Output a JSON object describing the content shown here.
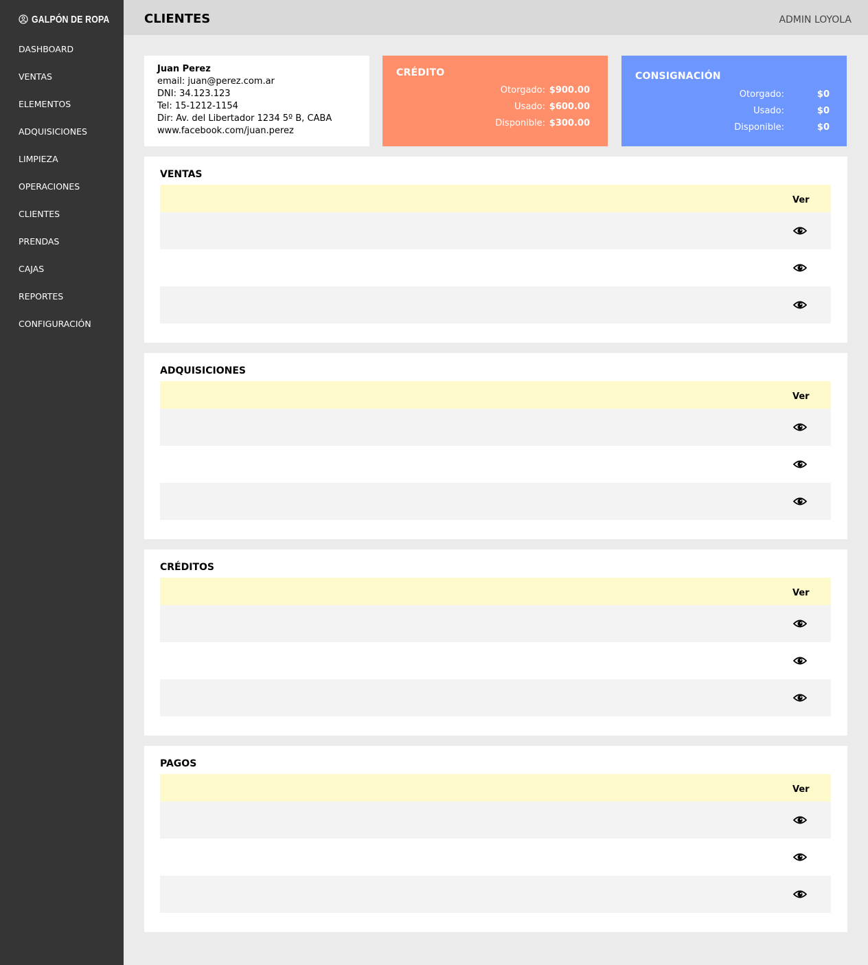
{
  "brand": {
    "name": "GALPÓN DE ROPA",
    "icon": "brand-logo-icon"
  },
  "sidebar": {
    "items": [
      {
        "label": "DASHBOARD"
      },
      {
        "label": "VENTAS"
      },
      {
        "label": "ELEMENTOS"
      },
      {
        "label": "ADQUISICIONES"
      },
      {
        "label": "LIMPIEZA"
      },
      {
        "label": "OPERACIONES"
      },
      {
        "label": "CLIENTES"
      },
      {
        "label": "PRENDAS"
      },
      {
        "label": "CAJAS"
      },
      {
        "label": "REPORTES"
      },
      {
        "label": "CONFIGURACIÓN"
      }
    ]
  },
  "header": {
    "title": "CLIENTES",
    "user": "ADMIN LOYOLA"
  },
  "client": {
    "name": "Juan Perez",
    "email": "email: juan@perez.com.ar",
    "dni": "DNI: 34.123.123",
    "tel": "Tel: 15-1212-1154",
    "dir": "Dir: Av. del Libertador 1234 5º B, CABA",
    "web": "www.facebook.com/juan.perez"
  },
  "credit": {
    "title": "CRÉDITO",
    "rows": [
      {
        "label": "Otorgado:",
        "value": "$900.00"
      },
      {
        "label": "Usado:",
        "value": "$600.00"
      },
      {
        "label": "Disponible:",
        "value": "$300.00"
      }
    ],
    "color": "#ff8f6a"
  },
  "consign": {
    "title": "CONSIGNACIÓN",
    "rows": [
      {
        "label": "Otorgado:",
        "value": "$0"
      },
      {
        "label": "Usado:",
        "value": "$0"
      },
      {
        "label": "Disponible:",
        "value": "$0"
      }
    ],
    "color": "#6e96ff"
  },
  "sections": [
    {
      "title": "VENTAS",
      "col_header": "Ver",
      "rows": 3,
      "row_icon": "eye-icon"
    },
    {
      "title": "ADQUISICIONES",
      "col_header": "Ver",
      "rows": 3,
      "row_icon": "eye-icon"
    },
    {
      "title": "CRÉDITOS",
      "col_header": "Ver",
      "rows": 3,
      "row_icon": "eye-icon"
    },
    {
      "title": "PAGOS",
      "col_header": "Ver",
      "rows": 3,
      "row_icon": "eye-icon"
    }
  ],
  "colors": {
    "sidebar": "#353535",
    "header": "#d9d9d9",
    "table_head": "#fffacc"
  }
}
